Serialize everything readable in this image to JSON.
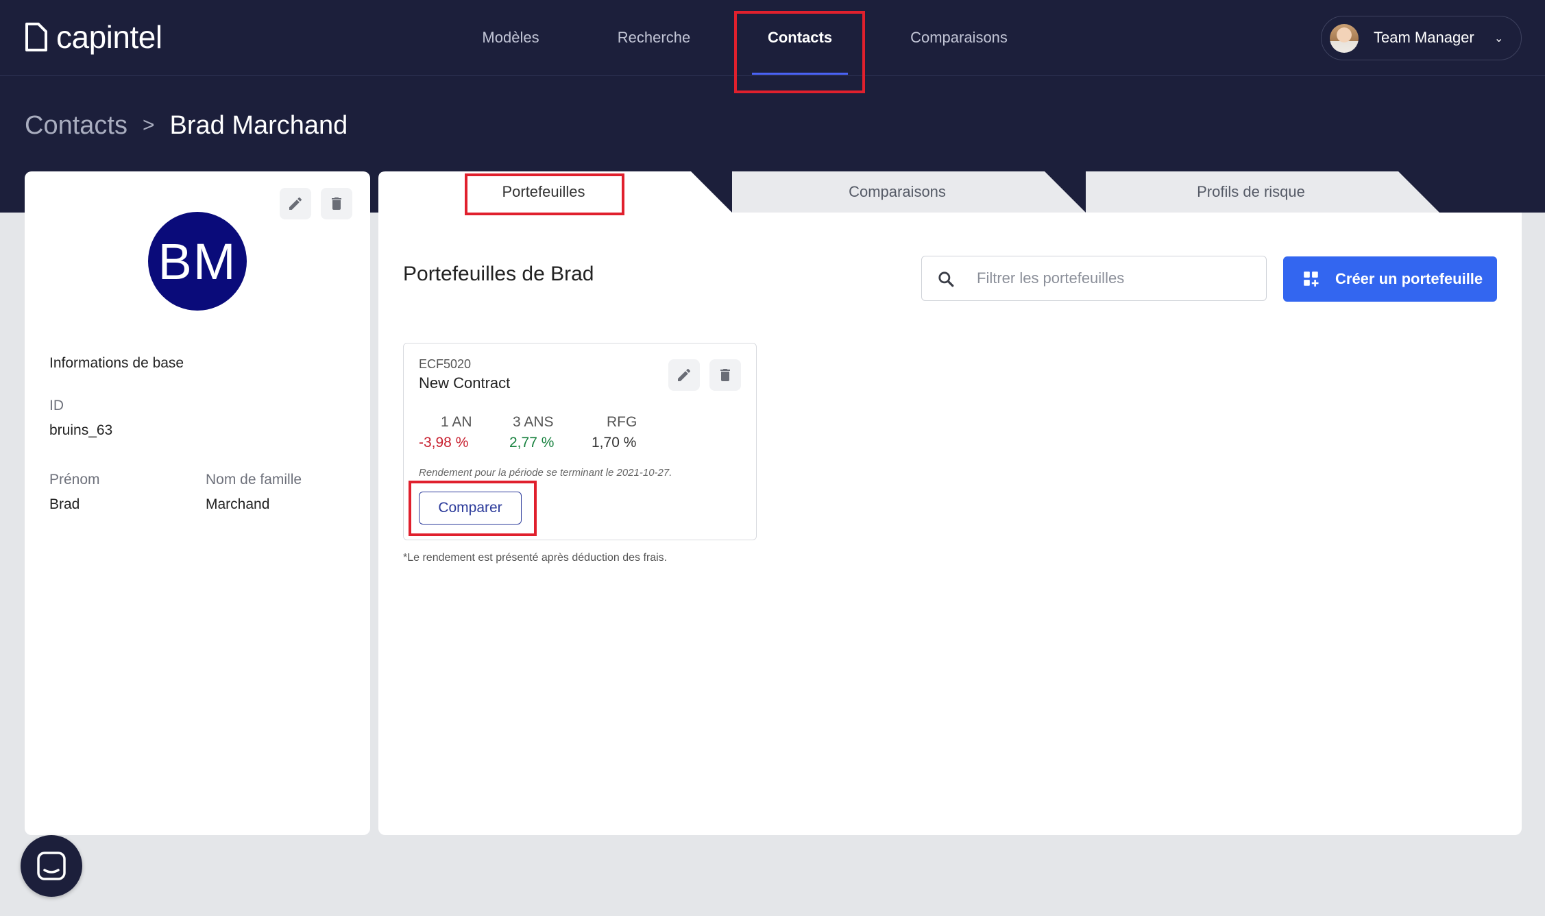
{
  "brand": {
    "name": "capintel"
  },
  "nav": {
    "items": [
      {
        "label": "Modèles"
      },
      {
        "label": "Recherche"
      },
      {
        "label": "Contacts"
      },
      {
        "label": "Comparaisons"
      }
    ],
    "active": "Contacts"
  },
  "user": {
    "name": "Team Manager"
  },
  "breadcrumb": {
    "root": "Contacts",
    "current": "Brad Marchand"
  },
  "profile": {
    "initials": "BM",
    "section_title": "Informations de base",
    "id_label": "ID",
    "id_value": "bruins_63",
    "first_name_label": "Prénom",
    "first_name_value": "Brad",
    "last_name_label": "Nom de famille",
    "last_name_value": "Marchand"
  },
  "tabs": [
    {
      "label": "Portefeuilles"
    },
    {
      "label": "Comparaisons"
    },
    {
      "label": "Profils de risque"
    }
  ],
  "main": {
    "title": "Portefeuilles de Brad",
    "search_placeholder": "Filtrer les portefeuilles",
    "create_label": "Créer un portefeuille"
  },
  "portfolio": {
    "code": "ECF5020",
    "name": "New Contract",
    "metrics": [
      {
        "label": "1 AN",
        "value": "-3,98 %",
        "trend": "negative"
      },
      {
        "label": "3 ANS",
        "value": "2,77 %",
        "trend": "positive"
      },
      {
        "label": "RFG",
        "value": "1,70 %",
        "trend": "neutral"
      }
    ],
    "note": "Rendement pour la période se terminant le 2021-10-27.",
    "compare_label": "Comparer"
  },
  "footnote": "*Le rendement est présenté après déduction des frais.",
  "colors": {
    "header_bg": "#1c1f3b",
    "accent": "#3366f0",
    "avatar_bg": "#0a0b7a",
    "negative": "#c8202f",
    "positive": "#17813e",
    "highlight": "#e0202d"
  }
}
